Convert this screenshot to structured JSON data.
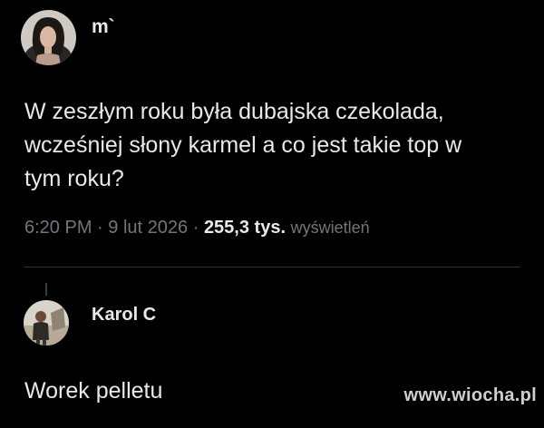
{
  "tweet": {
    "author_name": "m`",
    "text_line1": "W zeszłym roku była dubajska czekolada,",
    "text_line2": "wcześniej słony karmel a co jest takie top w",
    "text_line3": "tym roku?",
    "time": "6:20 PM",
    "separator": "·",
    "date": "9 lut 2026",
    "views_count": "255,3 tys.",
    "views_label": "wyświetleń"
  },
  "reply": {
    "author_name": "Karol C",
    "text": "Worek pelletu"
  },
  "watermark": "www.wiocha.pl"
}
